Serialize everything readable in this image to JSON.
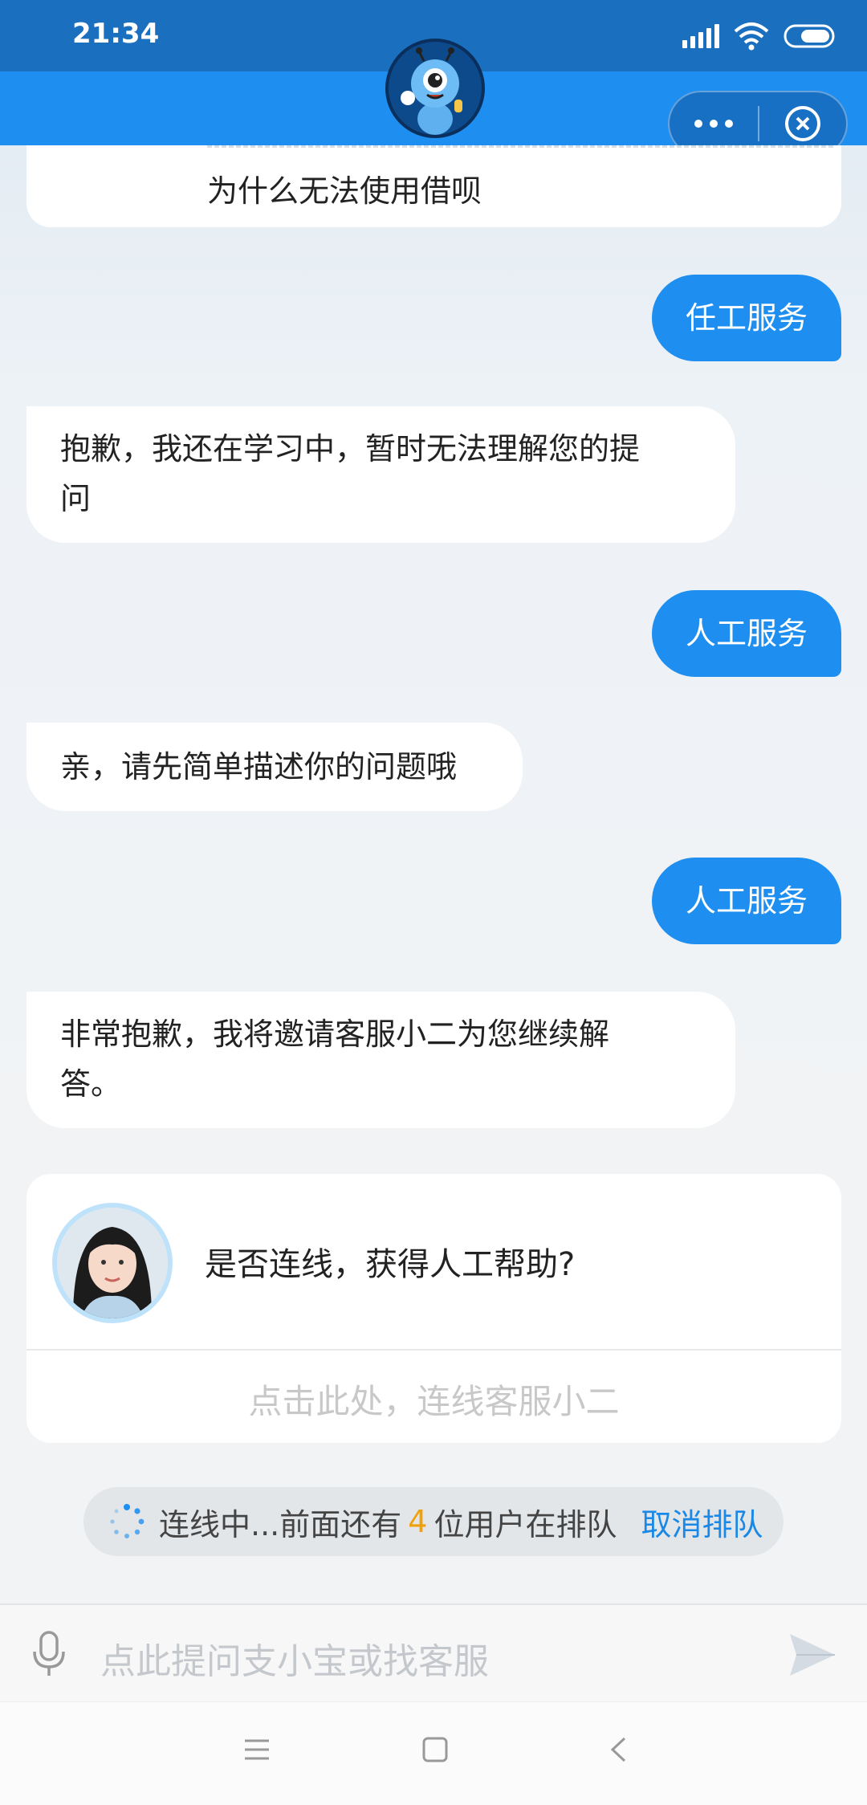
{
  "status_bar": {
    "time": "21:34"
  },
  "header": {
    "mascot": "robot-mascot-avatar",
    "more_icon": "more-dots-icon",
    "close_icon": "close-circle-icon"
  },
  "messages": [
    {
      "role": "bot",
      "text": "为什么无法使用借呗"
    },
    {
      "role": "user",
      "text": "任工服务"
    },
    {
      "role": "bot",
      "line1": "抱歉，我还在学习中，暂时无法理解您的提",
      "line2": "问"
    },
    {
      "role": "user",
      "text": "人工服务"
    },
    {
      "role": "bot",
      "text": "亲，请先简单描述你的问题哦"
    },
    {
      "role": "user",
      "text": "人工服务"
    },
    {
      "role": "bot",
      "line1": "非常抱歉，我将邀请客服小二为您继续解",
      "line2": "答。"
    }
  ],
  "agent_card": {
    "question": "是否连线，获得人工帮助?",
    "connect_label": "点击此处，连线客服小二"
  },
  "queue": {
    "prefix": "连线中...前面还有",
    "count": "4",
    "suffix": "位用户在排队",
    "cancel_label": "取消排队"
  },
  "input": {
    "placeholder": "点此提问支小宝或找客服"
  },
  "colors": {
    "accent": "#1e8ff0",
    "status_bar": "#1a6fbf",
    "queue_count": "#f0a00a",
    "link": "#1a88e6"
  }
}
